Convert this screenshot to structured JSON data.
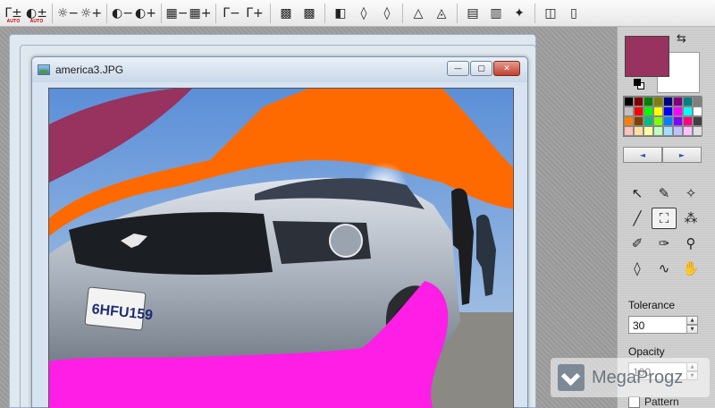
{
  "toolbar": {
    "buttons": [
      {
        "icon": "levels-auto-icon",
        "glyph": "Γ±",
        "sub": "AUTO"
      },
      {
        "icon": "contrast-auto-icon",
        "glyph": "◐±",
        "sub": "AUTO"
      },
      {
        "icon": "brightness-minus-icon",
        "glyph": "☼−"
      },
      {
        "icon": "brightness-plus-icon",
        "glyph": "☼+"
      },
      {
        "icon": "contrast-minus-icon",
        "glyph": "◐−"
      },
      {
        "icon": "contrast-plus-icon",
        "glyph": "◐+"
      },
      {
        "icon": "saturation-minus-icon",
        "glyph": "▦−"
      },
      {
        "icon": "saturation-plus-icon",
        "glyph": "▦+"
      },
      {
        "icon": "gamma-minus-icon",
        "glyph": "Γ−"
      },
      {
        "icon": "gamma-plus-icon",
        "glyph": "Γ+"
      },
      {
        "icon": "blur-icon",
        "glyph": "▩"
      },
      {
        "icon": "sharpen-icon",
        "glyph": "▩"
      },
      {
        "icon": "grayscale-icon",
        "glyph": "◧"
      },
      {
        "icon": "drop-icon",
        "glyph": "◊"
      },
      {
        "icon": "drop-outline-icon",
        "glyph": "◊"
      },
      {
        "icon": "sepia-icon",
        "glyph": "△"
      },
      {
        "icon": "invert-icon",
        "glyph": "◬"
      },
      {
        "icon": "color-balance-icon",
        "glyph": "▤"
      },
      {
        "icon": "hue-icon",
        "glyph": "▥"
      },
      {
        "icon": "effects-icon",
        "glyph": "✦"
      },
      {
        "icon": "compare-icon",
        "glyph": "◫"
      },
      {
        "icon": "side-by-side-icon",
        "glyph": "▯"
      }
    ]
  },
  "document": {
    "title": "america3.JPG",
    "minimize": "—",
    "maximize": "▢",
    "close": "✕"
  },
  "colors": {
    "foreground": "#98325e",
    "background": "#ffffff",
    "swap_glyph": "⇆"
  },
  "palette": [
    "#000000",
    "#800000",
    "#008000",
    "#808000",
    "#000080",
    "#800080",
    "#008080",
    "#808080",
    "#c0c0c0",
    "#ff0000",
    "#00ff00",
    "#ffff00",
    "#0000ff",
    "#ff00ff",
    "#00ffff",
    "#ffffff",
    "#ff8000",
    "#804000",
    "#00c080",
    "#80ff00",
    "#0080ff",
    "#8000ff",
    "#ff0080",
    "#404040",
    "#ffc0c0",
    "#ffe0a0",
    "#ffffa0",
    "#c0ffc0",
    "#a0e0ff",
    "#c0c0ff",
    "#ffc0ff",
    "#e0e0e0"
  ],
  "palette_nav": {
    "prev": "◄",
    "next": "►"
  },
  "tools": [
    {
      "icon": "pointer-icon",
      "glyph": "↖"
    },
    {
      "icon": "eyedropper-icon",
      "glyph": "✎"
    },
    {
      "icon": "magic-wand-icon",
      "glyph": "✧"
    },
    {
      "icon": "line-icon",
      "glyph": "╱"
    },
    {
      "icon": "paint-bucket-icon",
      "glyph": "⛶"
    },
    {
      "icon": "spray-icon",
      "glyph": "⁂"
    },
    {
      "icon": "brush-icon",
      "glyph": "✐"
    },
    {
      "icon": "brush-plus-icon",
      "glyph": "✑"
    },
    {
      "icon": "stamp-icon",
      "glyph": "⚲"
    },
    {
      "icon": "drop-tool-icon",
      "glyph": "◊"
    },
    {
      "icon": "smudge-icon",
      "glyph": "∿"
    },
    {
      "icon": "hand-icon",
      "glyph": "✋"
    }
  ],
  "tolerance": {
    "label": "Tolerance",
    "value": "30"
  },
  "opacity": {
    "label": "Opacity",
    "value": "100"
  },
  "pattern": {
    "label": "Pattern"
  },
  "spin": {
    "up": "▲",
    "down": "▼"
  },
  "watermark": {
    "text": "MegaProgz"
  }
}
